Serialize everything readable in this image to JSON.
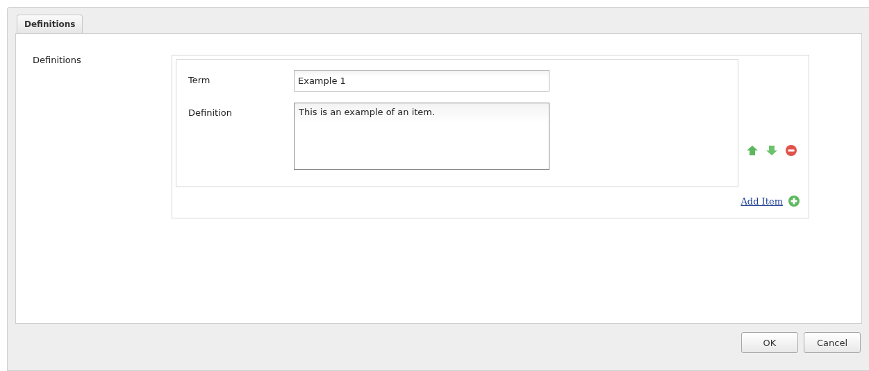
{
  "tabs": [
    {
      "label": "Definitions",
      "selected": true
    }
  ],
  "field_label": "Definitions",
  "items": [
    {
      "term_label": "Term",
      "term_value": "Example 1",
      "definition_label": "Definition",
      "definition_value": "This is an example of an item."
    }
  ],
  "add_item": "Add Item",
  "buttons": [
    "OK",
    "Cancel"
  ]
}
